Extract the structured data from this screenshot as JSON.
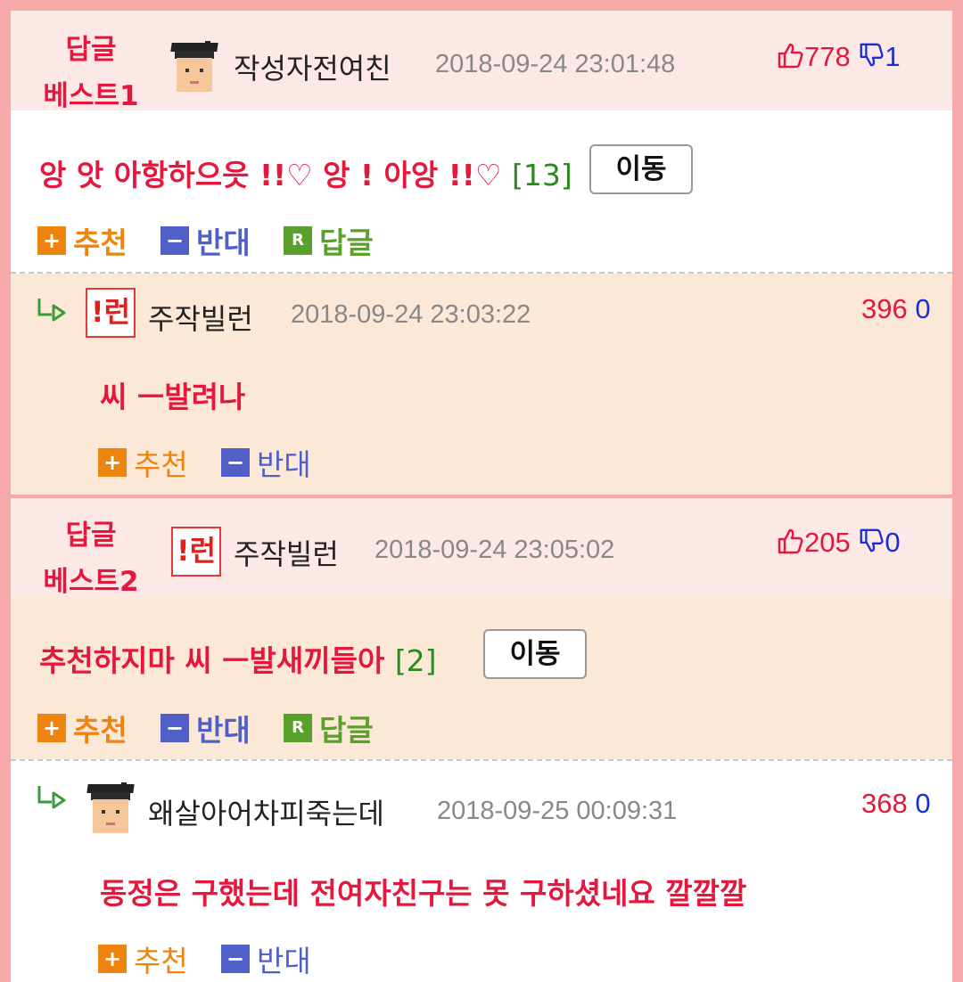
{
  "best1": {
    "label_top": "답글",
    "label_bottom": "베스트1",
    "nickname": "작성자전여친",
    "datetime": "2018-09-24 23:01:48",
    "up": "778",
    "down": "1",
    "comment": "앙 앗 아항하으읏 !!♡ 앙 ! 아앙 !!♡",
    "reply_count": "[13]",
    "move_label": "이동",
    "actions": {
      "recommend": "추천",
      "oppose": "반대",
      "reply": "답글"
    }
  },
  "reply1": {
    "nickname": "주작빌런",
    "datetime": "2018-09-24 23:03:22",
    "up": "396",
    "down": "0",
    "avatar_text": "!런",
    "comment": "씨 ㅡ발려나",
    "actions": {
      "recommend": "추천",
      "oppose": "반대"
    }
  },
  "best2": {
    "label_top": "답글",
    "label_bottom": "베스트2",
    "nickname": "주작빌런",
    "datetime": "2018-09-24 23:05:02",
    "up": "205",
    "down": "0",
    "avatar_text": "!런",
    "comment": "추천하지마 씨 ㅡ발새끼들아",
    "reply_count": "[2]",
    "move_label": "이동",
    "actions": {
      "recommend": "추천",
      "oppose": "반대",
      "reply": "답글"
    }
  },
  "reply2": {
    "nickname": "왜살아어차피죽는데",
    "datetime": "2018-09-25 00:09:31",
    "up": "368",
    "down": "0",
    "comment": "동정은 구했는데 전여자친구는 못 구하셨네요 깔깔깔",
    "actions": {
      "recommend": "추천",
      "oppose": "반대"
    }
  },
  "colors": {
    "accent_red": "#e3183c",
    "recommend_orange": "#ee8410",
    "oppose_blue": "#5060c8",
    "reply_green": "#5aa02c",
    "down_blue": "#1a2ed6"
  },
  "icons": [
    "thumbs-up-icon",
    "thumbs-down-icon",
    "reply-arrow-icon",
    "plus-icon",
    "minus-icon",
    "r-icon"
  ]
}
